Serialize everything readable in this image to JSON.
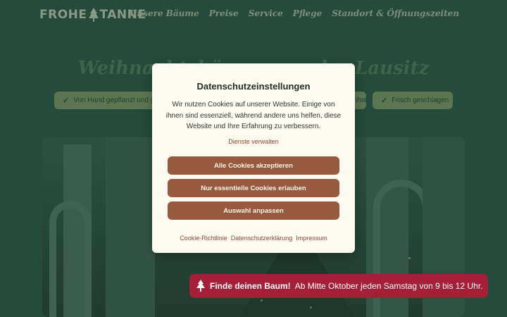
{
  "header": {
    "logo_left": "FROHE",
    "logo_right": "TANNE",
    "nav": [
      "Unsere Bäume",
      "Preise",
      "Service",
      "Pflege",
      "Standort & Öffnungszeiten"
    ]
  },
  "hero": {
    "title": "Weihnachtsbäume aus der Lausitz",
    "pills": [
      "Von Hand gepflanzt und gepflegt",
      "Nachhaltig",
      "Frisch geschlagen"
    ]
  },
  "cookie_dialog": {
    "title": "Datenschutzeinstellungen",
    "text": "Wir nutzen Cookies auf unserer Website. Einige von ihnen sind essenziell, während andere uns helfen, diese Website und Ihre Erfahrung zu verbessern.",
    "manage_link": "Dienste verwalten",
    "accept_all": "Alle Cookies akzeptieren",
    "essential_only": "Nur essentielle Cookies erlauben",
    "customize": "Auswahl anpassen",
    "links": [
      "Cookie-Richtlinie",
      "Datenschutzerklärung",
      "Impressum"
    ]
  },
  "banner": {
    "icon": "tree-icon",
    "strong": "Finde deinen Baum!",
    "text": "Ab Mitte Oktober jeden Samstag von 9 bis 12 Uhr."
  },
  "colors": {
    "background": "#2c5848",
    "button": "#985a3f",
    "banner": "#a51f37",
    "dialog": "#fdfaf2"
  }
}
